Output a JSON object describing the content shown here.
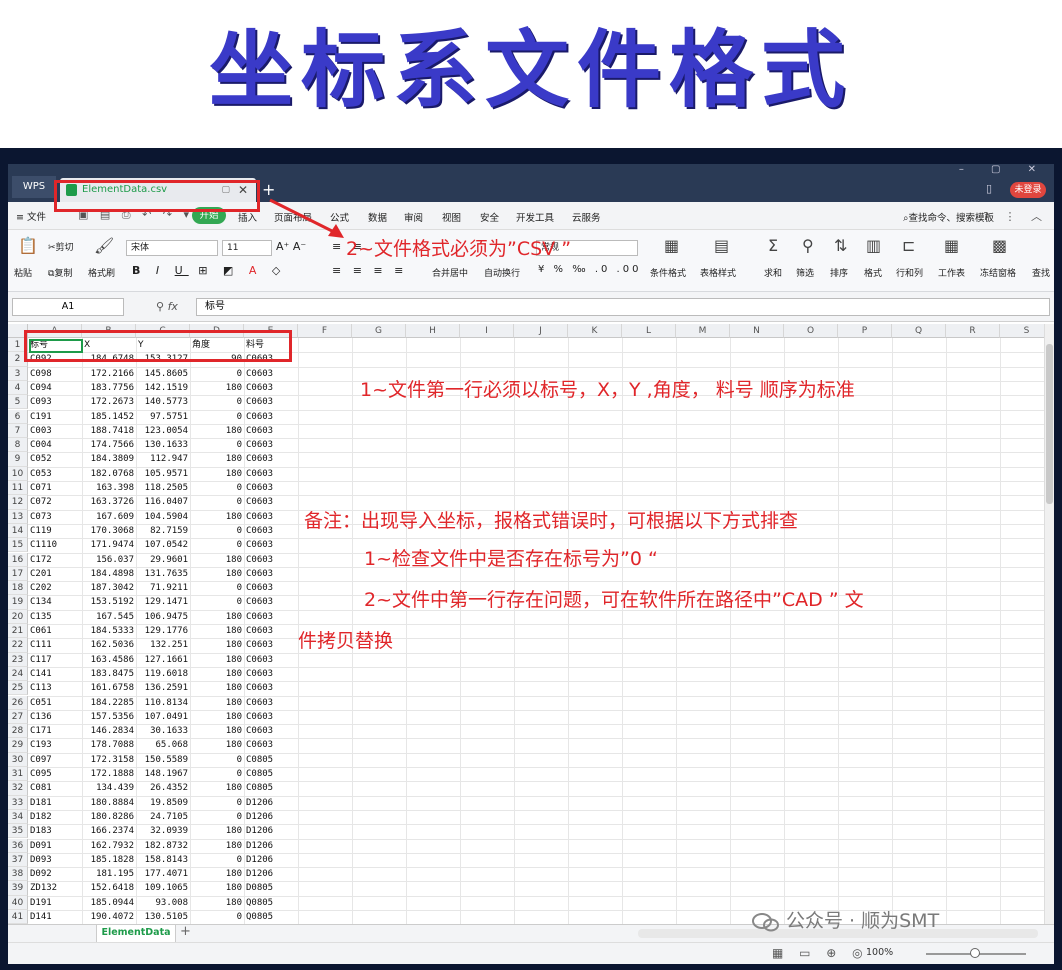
{
  "slide": {
    "title": "坐标系文件格式"
  },
  "titlebar": {
    "wps_label": "WPS",
    "file_tab": "ElementData.csv",
    "login": "未登录"
  },
  "menu": {
    "file": "≡ 文件",
    "start": "开始",
    "items": [
      "插入",
      "页面布局",
      "公式",
      "数据",
      "审阅",
      "视图",
      "安全",
      "开发工具",
      "云服务"
    ],
    "search": "查找命令、搜索模板"
  },
  "ribbon": {
    "paste": "粘贴",
    "cut": "剪切",
    "copy": "复制",
    "format_painter": "格式刷",
    "font_name": "宋体",
    "font_size": "11",
    "number_format": "常规",
    "merge": "合并居中",
    "wrap": "自动换行",
    "cond_format": "条件格式",
    "table_style": "表格样式",
    "sum": "求和",
    "filter": "筛选",
    "sort": "排序",
    "format": "格式",
    "rows_cols": "行和列",
    "worksheet": "工作表",
    "freeze": "冻结窗格",
    "find": "查找"
  },
  "formula_bar": {
    "cell_ref": "A1",
    "fx": "fx",
    "value": "标号"
  },
  "columns": [
    "A",
    "B",
    "C",
    "D",
    "E",
    "F",
    "G",
    "H",
    "I",
    "J",
    "K",
    "L",
    "M",
    "N",
    "O",
    "P",
    "Q",
    "R",
    "S"
  ],
  "header_row": [
    "标号",
    "X",
    "Y",
    "角度",
    "料号"
  ],
  "rows": [
    [
      "C092",
      "184.6748",
      "153.3127",
      "90",
      "C0603"
    ],
    [
      "C098",
      "172.2166",
      "145.8605",
      "0",
      "C0603"
    ],
    [
      "C094",
      "183.7756",
      "142.1519",
      "180",
      "C0603"
    ],
    [
      "C093",
      "172.2673",
      "140.5773",
      "0",
      "C0603"
    ],
    [
      "C191",
      "185.1452",
      "97.5751",
      "0",
      "C0603"
    ],
    [
      "C003",
      "188.7418",
      "123.0054",
      "180",
      "C0603"
    ],
    [
      "C004",
      "174.7566",
      "130.1633",
      "0",
      "C0603"
    ],
    [
      "C052",
      "184.3809",
      "112.947",
      "180",
      "C0603"
    ],
    [
      "C053",
      "182.0768",
      "105.9571",
      "180",
      "C0603"
    ],
    [
      "C071",
      "163.398",
      "118.2505",
      "0",
      "C0603"
    ],
    [
      "C072",
      "163.3726",
      "116.0407",
      "0",
      "C0603"
    ],
    [
      "C073",
      "167.609",
      "104.5904",
      "180",
      "C0603"
    ],
    [
      "C119",
      "170.3068",
      "82.7159",
      "0",
      "C0603"
    ],
    [
      "C1110",
      "171.9474",
      "107.0542",
      "0",
      "C0603"
    ],
    [
      "C172",
      "156.037",
      "29.9601",
      "180",
      "C0603"
    ],
    [
      "C201",
      "184.4898",
      "131.7635",
      "180",
      "C0603"
    ],
    [
      "C202",
      "187.3042",
      "71.9211",
      "0",
      "C0603"
    ],
    [
      "C134",
      "153.5192",
      "129.1471",
      "0",
      "C0603"
    ],
    [
      "C135",
      "167.545",
      "106.9475",
      "180",
      "C0603"
    ],
    [
      "C061",
      "184.5333",
      "129.1776",
      "180",
      "C0603"
    ],
    [
      "C111",
      "162.5036",
      "132.251",
      "180",
      "C0603"
    ],
    [
      "C117",
      "163.4586",
      "127.1661",
      "180",
      "C0603"
    ],
    [
      "C141",
      "183.8475",
      "119.6018",
      "180",
      "C0603"
    ],
    [
      "C113",
      "161.6758",
      "136.2591",
      "180",
      "C0603"
    ],
    [
      "C051",
      "184.2285",
      "110.8134",
      "180",
      "C0603"
    ],
    [
      "C136",
      "157.5356",
      "107.0491",
      "180",
      "C0603"
    ],
    [
      "C171",
      "146.2834",
      "30.1633",
      "180",
      "C0603"
    ],
    [
      "C193",
      "178.7088",
      "65.068",
      "180",
      "C0603"
    ],
    [
      "C097",
      "172.3158",
      "150.5589",
      "0",
      "C0805"
    ],
    [
      "C095",
      "172.1888",
      "148.1967",
      "0",
      "C0805"
    ],
    [
      "C081",
      "134.439",
      "26.4352",
      "180",
      "C0805"
    ],
    [
      "D181",
      "180.8884",
      "19.8509",
      "0",
      "D1206"
    ],
    [
      "D182",
      "180.8286",
      "24.7105",
      "0",
      "D1206"
    ],
    [
      "D183",
      "166.2374",
      "32.0939",
      "180",
      "D1206"
    ],
    [
      "D091",
      "162.7932",
      "182.8732",
      "180",
      "D1206"
    ],
    [
      "D093",
      "185.1828",
      "158.8143",
      "0",
      "D1206"
    ],
    [
      "D092",
      "181.195",
      "177.4071",
      "180",
      "D1206"
    ],
    [
      "ZD132",
      "152.6418",
      "109.1065",
      "180",
      "D0805"
    ],
    [
      "D191",
      "185.0944",
      "93.008",
      "180",
      "Q0805"
    ],
    [
      "D141",
      "190.4072",
      "130.5105",
      "0",
      "Q0805"
    ]
  ],
  "sheet": {
    "tab": "ElementData",
    "add": "+"
  },
  "status": {
    "zoom": "100%"
  },
  "annotations": {
    "csv_note": "2~文件格式必须为”CSV ”",
    "row1_note": "1~文件第一行必须以标号，X，Y ,角度，  料号   顺序为标准",
    "remark": "备注：出现导入坐标，报格式错误时，可根据以下方式排查",
    "check1": "1~检查文件中是否存在标号为”0 “",
    "check2": "2~文件中第一行存在问题，可在软件所在路径中”CAD ”     文",
    "check2b": "件拷贝替换",
    "color": "#e0262a"
  },
  "watermark": "公众号 · 顺为SMT"
}
